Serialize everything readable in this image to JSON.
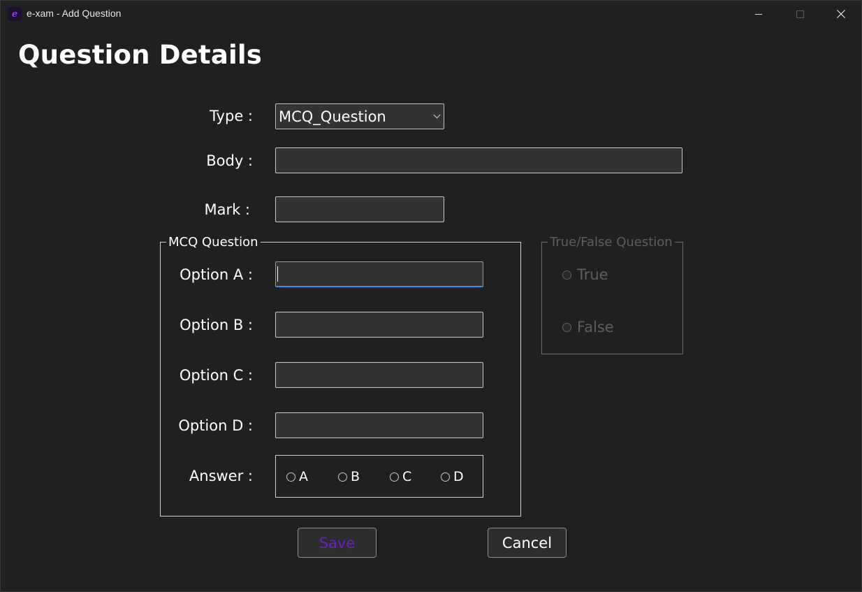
{
  "window": {
    "title": "e-xam - Add Question",
    "app_icon_glyph": "e"
  },
  "page": {
    "title": "Question Details"
  },
  "form": {
    "type_label": "Type :",
    "type_value": "MCQ_Question",
    "body_label": "Body :",
    "body_value": "",
    "mark_label": "Mark :",
    "mark_value": ""
  },
  "mcq": {
    "legend": "MCQ Question",
    "option_a_label": "Option A :",
    "option_b_label": "Option B :",
    "option_c_label": "Option C :",
    "option_d_label": "Option D :",
    "answer_label": "Answer :",
    "answer_choices": [
      "A",
      "B",
      "C",
      "D"
    ]
  },
  "truefalse": {
    "legend": "True/False Question",
    "true_label": "True",
    "false_label": "False"
  },
  "buttons": {
    "save": "Save",
    "cancel": "Cancel"
  },
  "colors": {
    "background": "#202020",
    "save_text": "#6a1fc4",
    "focus_accent": "#2f8fe8",
    "disabled_text": "#5e5e5e"
  }
}
